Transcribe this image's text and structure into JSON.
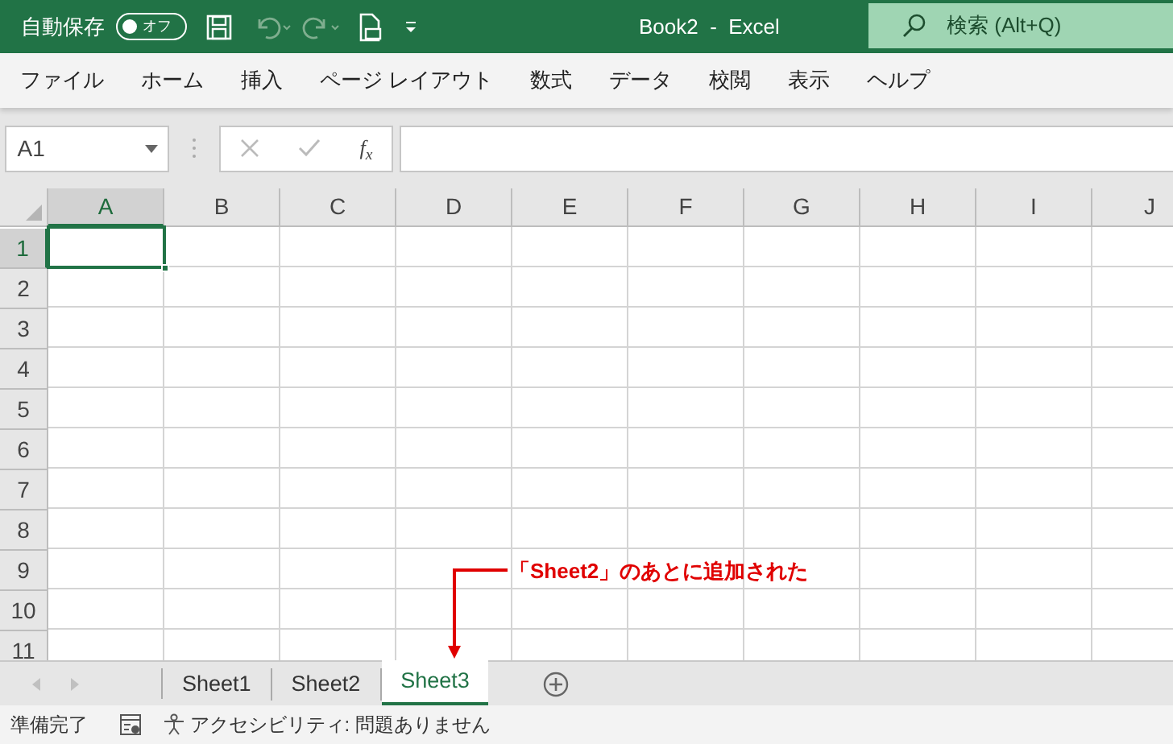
{
  "title_bar": {
    "autosave_label": "自動保存",
    "autosave_toggle": {
      "label": "オフ",
      "on": false
    },
    "title": "Book2  -  Excel",
    "search": {
      "placeholder": "検索 (Alt+Q)"
    }
  },
  "ribbon_tabs": [
    "ファイル",
    "ホーム",
    "挿入",
    "ページ レイアウト",
    "数式",
    "データ",
    "校閲",
    "表示",
    "ヘルプ"
  ],
  "formula_bar": {
    "name_box": "A1",
    "function_label": "f$_{x}$"
  },
  "grid": {
    "columns": [
      {
        "label": "A",
        "selected": true
      },
      {
        "label": "B",
        "selected": false
      },
      {
        "label": "C",
        "selected": false
      },
      {
        "label": "D",
        "selected": false
      },
      {
        "label": "E",
        "selected": false
      },
      {
        "label": "F",
        "selected": false
      },
      {
        "label": "G",
        "selected": false
      },
      {
        "label": "H",
        "selected": false
      },
      {
        "label": "I",
        "selected": false
      },
      {
        "label": "J",
        "selected": false
      }
    ],
    "rows": [
      {
        "label": "1",
        "selected": true
      },
      {
        "label": "2",
        "selected": false
      },
      {
        "label": "3",
        "selected": false
      },
      {
        "label": "4",
        "selected": false
      },
      {
        "label": "5",
        "selected": false
      },
      {
        "label": "6",
        "selected": false
      },
      {
        "label": "7",
        "selected": false
      },
      {
        "label": "8",
        "selected": false
      },
      {
        "label": "9",
        "selected": false
      },
      {
        "label": "10",
        "selected": false
      },
      {
        "label": "11",
        "selected": false
      }
    ]
  },
  "sheet_tabs": [
    {
      "label": "Sheet1",
      "selected": false
    },
    {
      "label": "Sheet2",
      "selected": false
    },
    {
      "label": "Sheet3",
      "selected": true
    }
  ],
  "annotation": {
    "text": "「Sheet2」のあとに追加された"
  },
  "status_bar": {
    "status": "準備完了",
    "accessibility": "アクセシビリティ: 問題ありません"
  }
}
